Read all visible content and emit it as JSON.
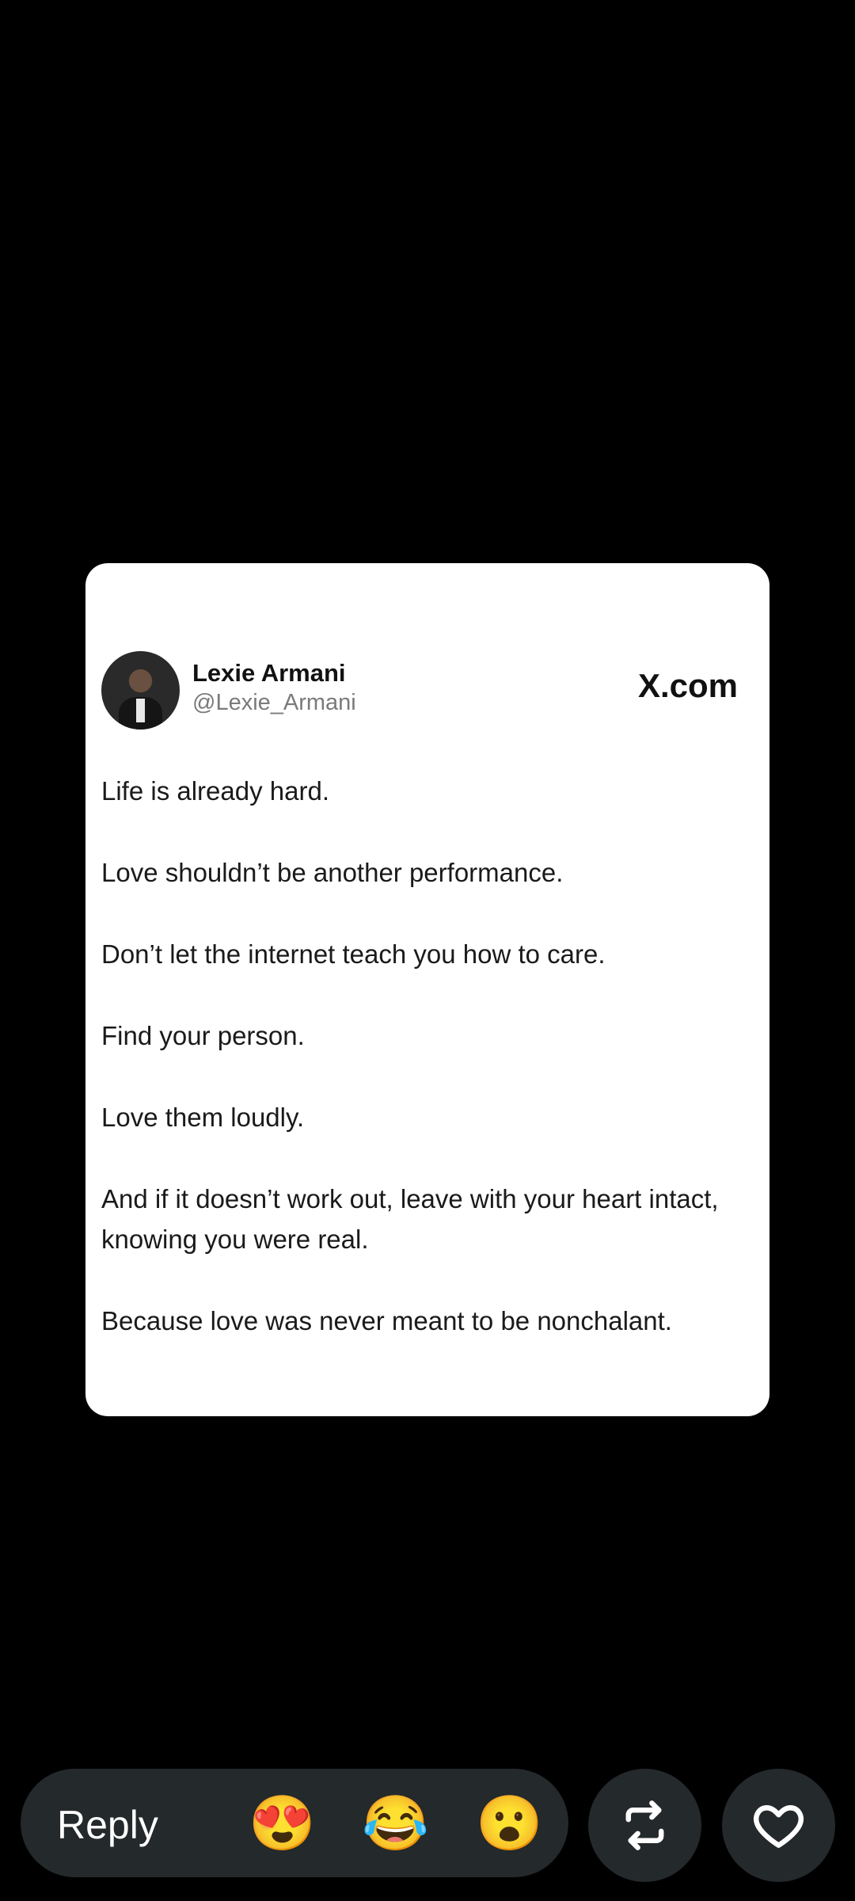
{
  "post": {
    "author_name": "Lexie Armani",
    "author_handle": "@Lexie_Armani",
    "source": "X.com",
    "lines": [
      "Life is already hard.",
      "Love shouldn’t be another performance.",
      "Don’t let the internet teach you how to care.",
      "Find your person.",
      "Love them loudly.",
      "And if it doesn’t work out, leave with your heart intact, knowing you were real.",
      "Because love was never meant to be nonchalant."
    ]
  },
  "actions": {
    "reply_label": "Reply",
    "reactions": [
      "😍",
      "😂",
      "😮"
    ],
    "repost_icon": "repost-icon",
    "like_icon": "heart-icon"
  },
  "colors": {
    "background": "#000000",
    "card": "#ffffff",
    "bar": "#24292b"
  }
}
